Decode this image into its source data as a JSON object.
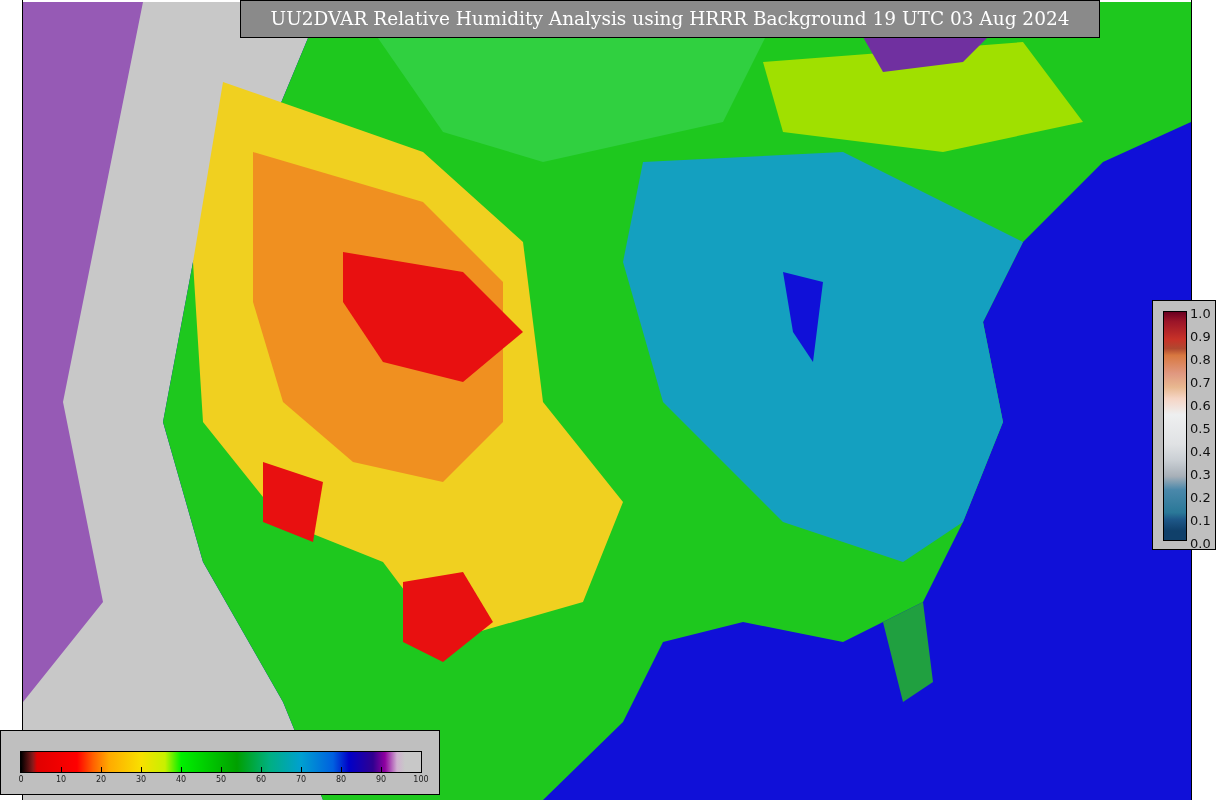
{
  "title": "UU2DVAR Relative Humidity Analysis using HRRR Background 19 UTC 03 Aug 2024",
  "humidity_colorbar": {
    "tick_labels": [
      "0",
      "10",
      "20",
      "30",
      "40",
      "50",
      "60",
      "70",
      "80",
      "90",
      "100"
    ]
  },
  "ratio_colorbar": {
    "tick_labels": [
      "1.0",
      "0.9",
      "0.8",
      "0.7",
      "0.6",
      "0.5",
      "0.4",
      "0.3",
      "0.2",
      "0.1",
      "0.0"
    ]
  }
}
